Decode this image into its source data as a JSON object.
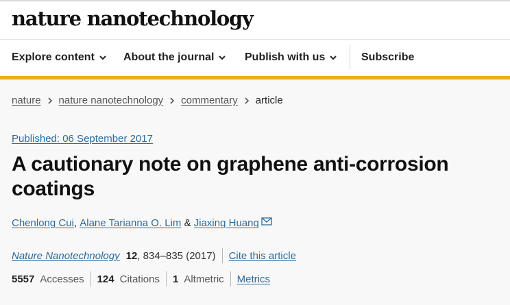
{
  "header": {
    "logo": "nature nanotechnology"
  },
  "nav": {
    "items": [
      {
        "label": "Explore content"
      },
      {
        "label": "About the journal"
      },
      {
        "label": "Publish with us"
      }
    ],
    "subscribe": "Subscribe"
  },
  "breadcrumb": {
    "items": [
      "nature",
      "nature nanotechnology",
      "commentary"
    ],
    "current": "article"
  },
  "article": {
    "published": "Published: 06 September 2017",
    "title": "A cautionary note on graphene anti-corrosion coatings",
    "authors": [
      "Chenlong Cui",
      "Alane Tarianna O. Lim",
      "Jiaxing Huang"
    ],
    "author_sep": ",",
    "author_and": "&"
  },
  "citation": {
    "journal": "Nature Nanotechnology",
    "volume": "12",
    "pages": ", 834–835 (2017)",
    "cite_link": "Cite this article"
  },
  "metrics": {
    "accesses_count": "5557",
    "accesses_label": "Accesses",
    "citations_count": "124",
    "citations_label": "Citations",
    "altmetric_count": "1",
    "altmetric_label": "Altmetric",
    "metrics_link": "Metrics"
  },
  "colors": {
    "accent": "#e6b01e",
    "link": "#2b6a9c"
  }
}
